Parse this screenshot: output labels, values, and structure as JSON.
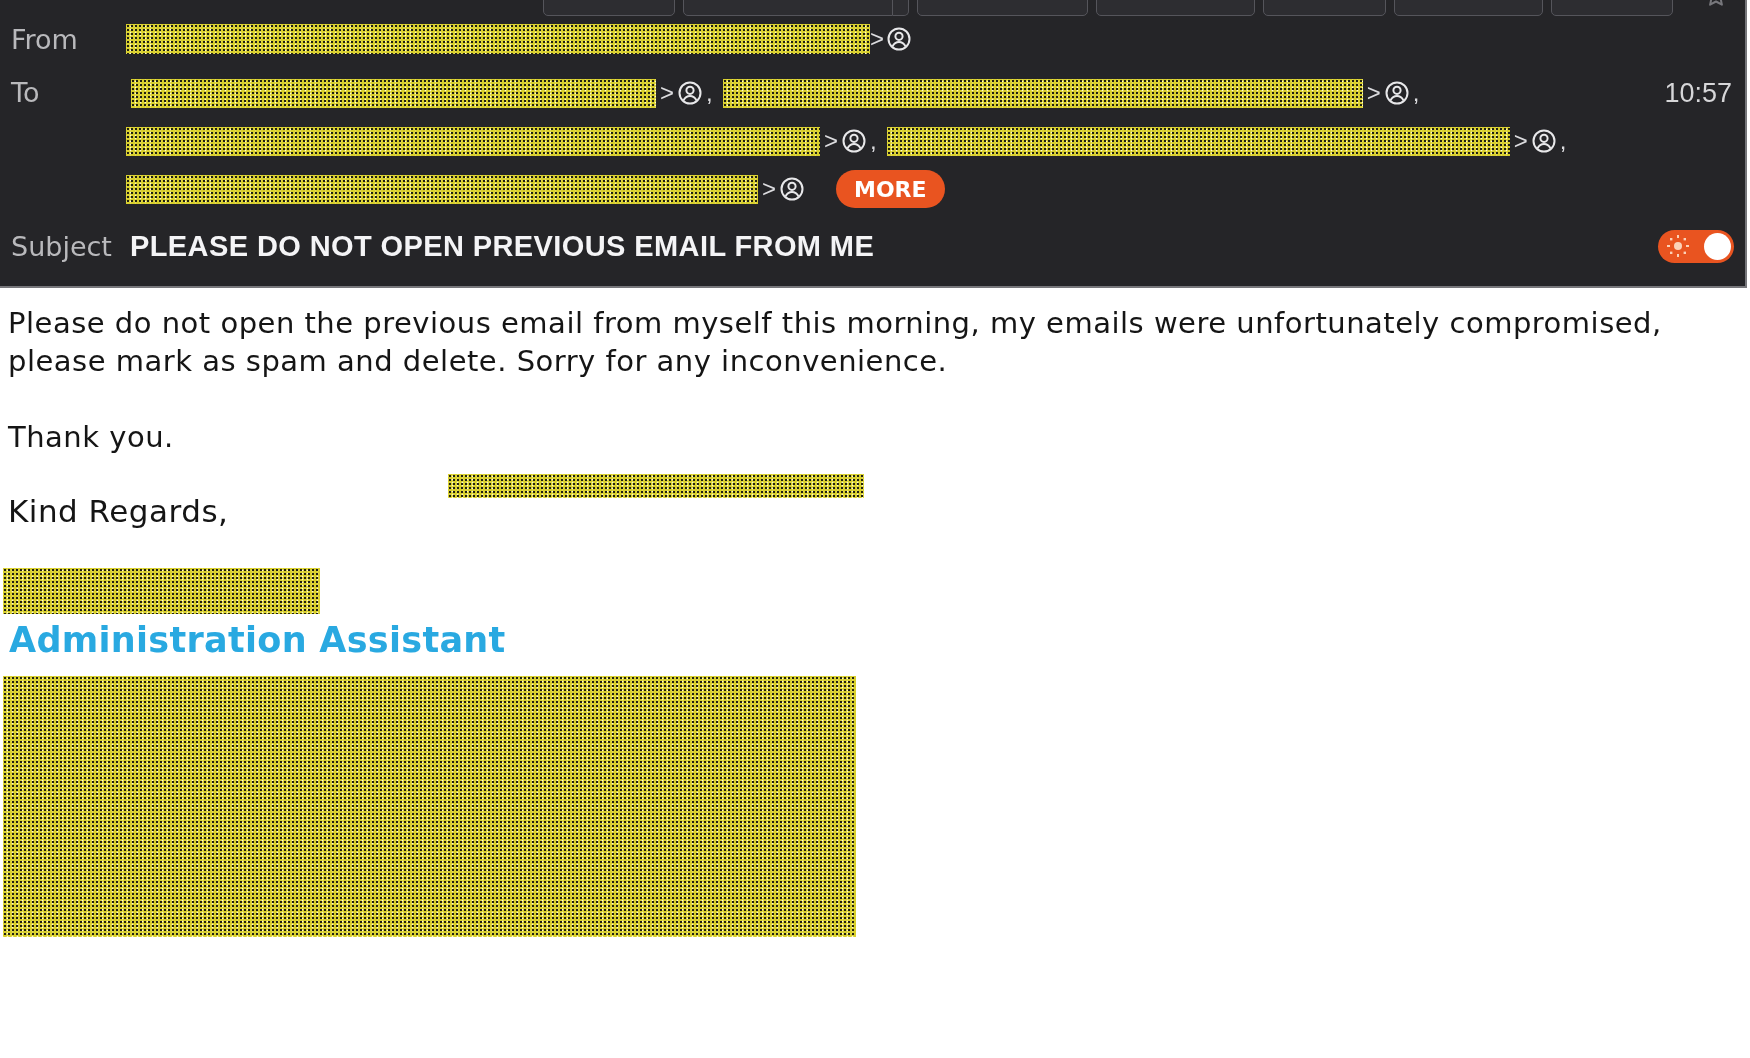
{
  "toolbar": {
    "buttons": [
      {
        "kind": "plain"
      },
      {
        "kind": "split"
      },
      {
        "kind": "plain"
      },
      {
        "kind": "plain"
      },
      {
        "kind": "plain"
      },
      {
        "kind": "plain"
      },
      {
        "kind": "plain"
      }
    ]
  },
  "header": {
    "from": {
      "label": "From",
      "visible_end": ">"
    },
    "to": {
      "label": "To",
      "recipients": [
        {
          "visible_end": ">",
          "separator": ","
        },
        {
          "visible_end": ">",
          "separator": ","
        },
        {
          "visible_end": ">",
          "separator": ","
        },
        {
          "visible_end": ">",
          "separator": ","
        },
        {
          "visible_end": ">"
        }
      ],
      "more_button": "MORE"
    },
    "time": "10:57",
    "subject": {
      "label": "Subject",
      "text": "PLEASE DO NOT OPEN PREVIOUS EMAIL FROM ME"
    },
    "view_toggle": {
      "on": true
    }
  },
  "body": {
    "paragraphs": [
      "Please do not open the previous email from myself this morning, my emails were unfortunately compromised, please mark as spam and delete. Sorry for any inconvenience.",
      "Thank you."
    ],
    "closing": "Kind Regards,",
    "signature_title": "Administration Assistant"
  }
}
